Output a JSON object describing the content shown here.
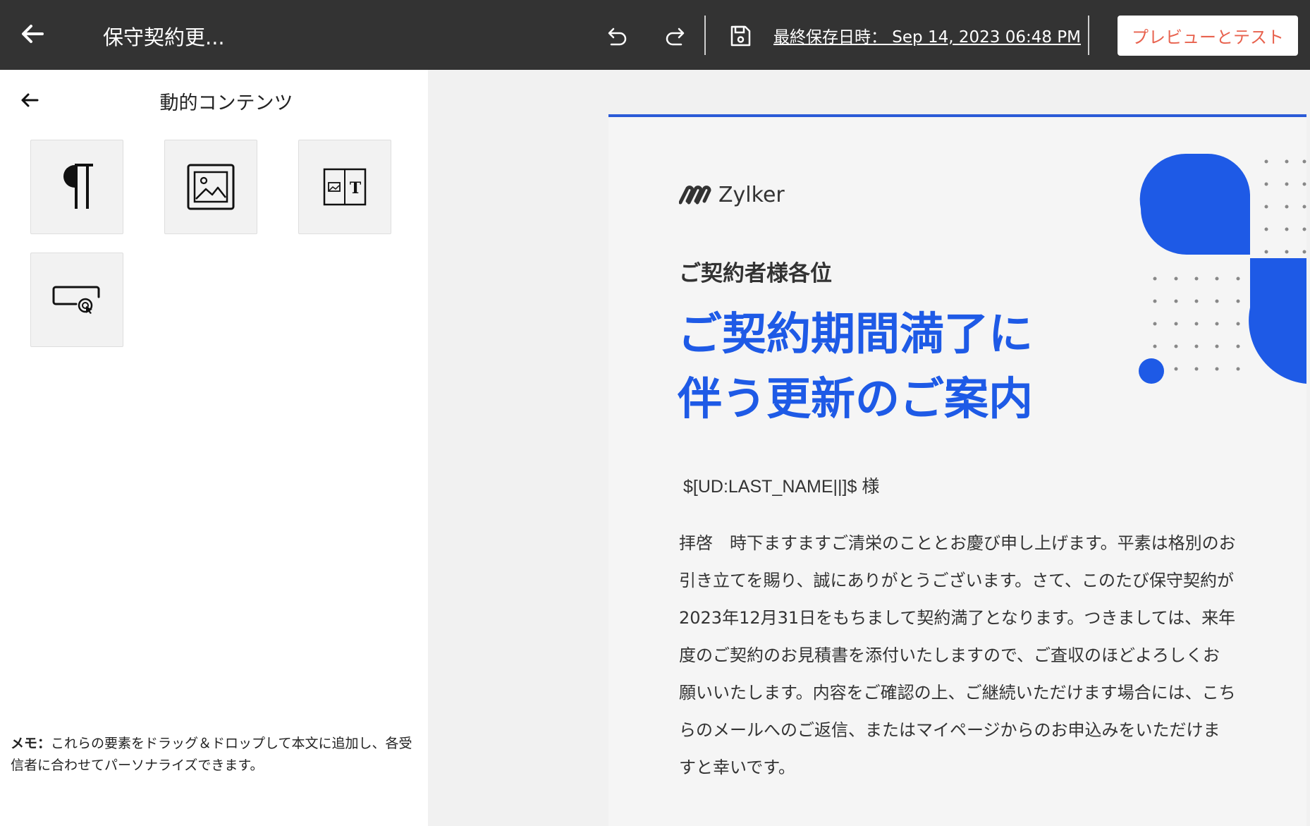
{
  "topbar": {
    "title": "保守契約更...",
    "last_saved": "最終保存日時： Sep 14, 2023 06:48 PM",
    "preview_button": "プレビューとテスト",
    "icons": [
      "back-arrow-icon",
      "undo-icon",
      "redo-icon",
      "save-icon"
    ]
  },
  "left_panel": {
    "title": "動的コンテンツ",
    "tiles": [
      {
        "name": "paragraph",
        "icon": "pilcrow-icon"
      },
      {
        "name": "image",
        "icon": "image-icon"
      },
      {
        "name": "image-text",
        "icon": "image-text-icon"
      },
      {
        "name": "button",
        "icon": "button-click-icon"
      }
    ],
    "memo_label": "メモ：",
    "memo_text": "これらの要素をドラッグ＆ドロップして本文に追加し、各受信者に合わせてパーソナライズできます。"
  },
  "email": {
    "logo_text": "Zylker",
    "greeting": "ご契約者様各位",
    "headline_line1": "ご契約期間満了に",
    "headline_line2": "伴う更新のご案内",
    "recipient": "$[UD:LAST_NAME||]$ 様",
    "body": "拝啓　時下ますますご清栄のこととお慶び申し上げます。平素は格別のお引き立てを賜り、誠にありがとうございます。さて、このたび保守契約が2023年12月31日をもちまして契約満了となります。つきましては、来年度のご契約のお見積書を添付いたしますので、ご査収のほどよろしくお願いいたします。内容をご確認の上、ご継続いただけます場合には、こちらのメールへのご返信、またはマイページからのお申込みをいただけますと幸いです。",
    "accent_color": "#1e5ae6"
  },
  "colors": {
    "topbar_bg": "#333333",
    "preview_text": "#e8624e",
    "accent": "#2b5bd7"
  }
}
